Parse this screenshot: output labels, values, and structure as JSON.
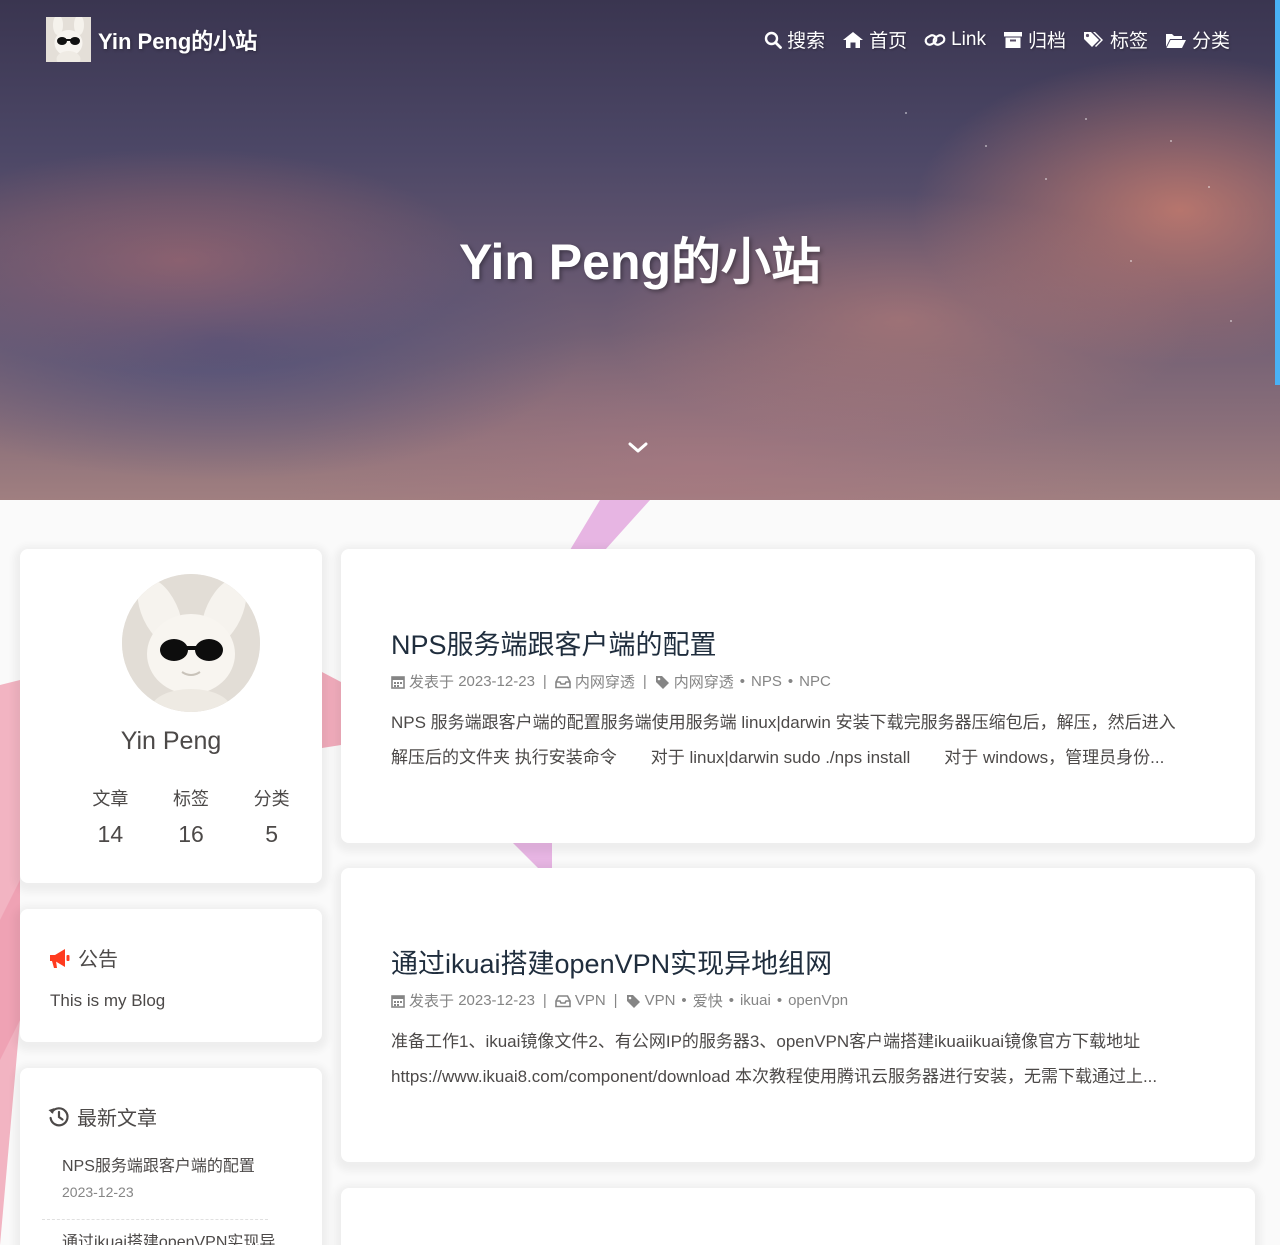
{
  "site": {
    "brand_title": "Yin Peng的小站",
    "hero_title": "Yin Peng的小站"
  },
  "nav": {
    "items": [
      {
        "label": "搜索",
        "icon": "search-icon"
      },
      {
        "label": "首页",
        "icon": "home-icon"
      },
      {
        "label": "Link",
        "icon": "link-icon"
      },
      {
        "label": "归档",
        "icon": "archive-icon"
      },
      {
        "label": "标签",
        "icon": "tags-icon"
      },
      {
        "label": "分类",
        "icon": "folder-open-icon"
      }
    ]
  },
  "author": {
    "name": "Yin Peng",
    "stats": [
      {
        "label": "文章",
        "value": "14"
      },
      {
        "label": "标签",
        "value": "16"
      },
      {
        "label": "分类",
        "value": "5"
      }
    ]
  },
  "announcement": {
    "heading": "公告",
    "text": "This is my Blog",
    "icon_color": "#ff3b1f"
  },
  "recent": {
    "heading": "最新文章",
    "items": [
      {
        "title": "NPS服务端跟客户端的配置",
        "date": "2023-12-23"
      },
      {
        "title": "通过ikuai搭建openVPN实现异",
        "date": ""
      }
    ]
  },
  "posts": [
    {
      "title": "NPS服务端跟客户端的配置",
      "published_label": "发表于",
      "date": "2023-12-23",
      "category": "内网穿透",
      "tags": [
        "内网穿透",
        "NPS",
        "NPC"
      ],
      "excerpt": [
        "NPS 服务端跟客户端的配置服务端使用服务端 linux|darwin 安装下载完服务器压缩包后，解压，然后进入",
        "解压后的文件夹 执行安装命令　　对于 linux|darwin sudo ./nps install　　对于 windows，管理员身份..."
      ]
    },
    {
      "title": "通过ikuai搭建openVPN实现异地组网",
      "published_label": "发表于",
      "date": "2023-12-23",
      "category": "VPN",
      "tags": [
        "VPN",
        "爱快",
        "ikuai",
        "openVpn"
      ],
      "excerpt": [
        "准备工作1、ikuai镜像文件2、有公网IP的服务器3、openVPN客户端搭建ikuaiikuai镜像官方下载地址",
        "https://www.ikuai8.com/component/download 本次教程使用腾讯云服务器进行安装，无需下载通过上..."
      ]
    }
  ],
  "colors": {
    "accent": "#49b1f5",
    "post_title": "#1f2d3d",
    "meta": "#858585"
  }
}
